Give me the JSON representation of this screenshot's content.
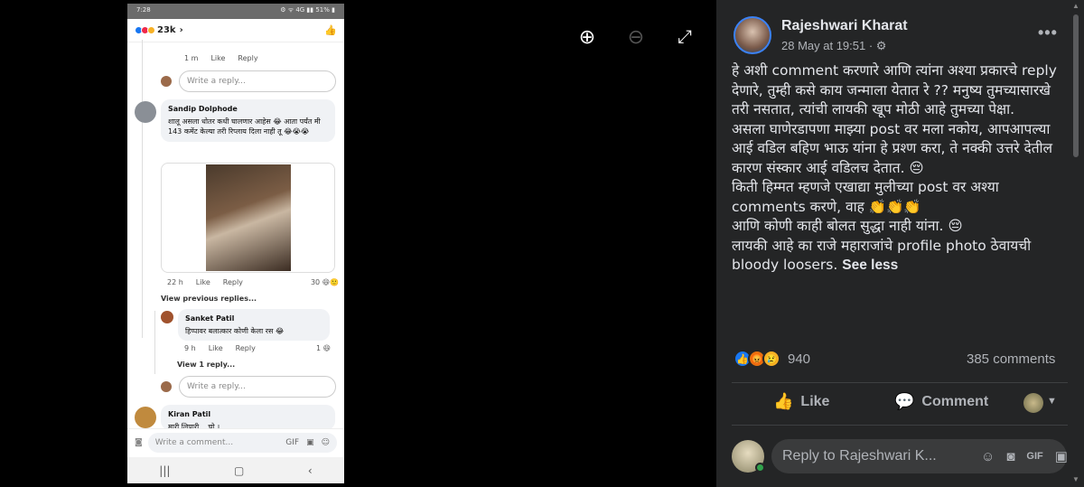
{
  "phone": {
    "status_time": "7:28",
    "status_icons": "⚙ ᯤ 4G ▮▮ 51% ▮",
    "reaction_count": "23k",
    "top_meta": {
      "time": "1 m",
      "like": "Like",
      "reply": "Reply"
    },
    "write_reply_placeholder": "Write a reply...",
    "comment1": {
      "name": "Sandip Dolphode",
      "text": "शालू असला धोतर कधी घालणार आहेस 😂 आता पर्यंत मी 143 कमेंट केल्या तरी रिप्लाय दिला नाही तू 😂😭😭",
      "time": "22 h",
      "like": "Like",
      "reply": "Reply",
      "reacts": "30 😆🙂"
    },
    "view_previous": "View previous replies...",
    "comment2": {
      "name": "Sanket Patil",
      "text": "हिप्पावर बलात्कार कोणी केला रस 😂",
      "time": "9 h",
      "like": "Like",
      "reply": "Reply",
      "reacts": "1 😆"
    },
    "view_one_reply": "View 1 reply...",
    "comment3": {
      "name": "Kiran Patil",
      "text": "मारी लिपारी ...चो ।"
    },
    "write_comment_placeholder": "Write a comment...",
    "nav": [
      "|||",
      "▢",
      "‹"
    ]
  },
  "toolbar": {
    "zoom_in": "⊕",
    "zoom_out": "⊖",
    "fullscreen": "⤢"
  },
  "post": {
    "author": "Rajeshwari Kharat",
    "date": "28 May at 19:51 · ",
    "privacy_icon": "⚙",
    "more": "•••",
    "paragraphs": [
      "हे अशी comment करणारे आणि त्यांना अश्या प्रकारचे reply देणारे, तुम्ही कसे काय जन्माला येतात रे ?? मनुष्य तुमच्यासारखे तरी नसतात, त्यांची लायकी खूप मोठी आहे तुमच्या पेक्षा.",
      "असला घाणेरडापणा माझ्या post वर मला नकोय, आपआपल्या आई वडिल बहिण भाऊ यांना हे प्रश्ण करा, ते नक्की उत्तरे देतील कारण संस्कार आई वडिलच देतात. 😔",
      "किती हिम्मत म्हणजे एखाद्या मुलीच्या post वर अश्या comments करणे, वाह 👏👏👏",
      "आणि कोणी काही बोलत सुद्धा नाही यांना. 😔",
      "लायकी आहे का राजे महाराजांचे profile photo ठेवायची bloody loosers."
    ],
    "see_less": "See less",
    "reaction_count": "940",
    "comments_count": "385 comments",
    "like_label": "Like",
    "comment_label": "Comment",
    "reply_placeholder": "Reply to Rajeshwari K..."
  },
  "colors": {
    "panel_bg": "#242526",
    "text": "#e4e6eb",
    "secondary": "#b0b3b8",
    "like_blue": "#1877f2",
    "online_green": "#31a24c"
  }
}
